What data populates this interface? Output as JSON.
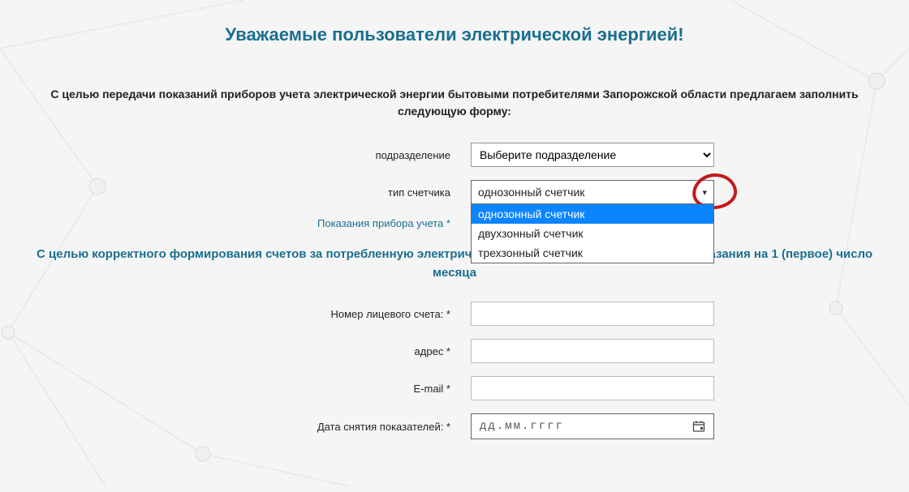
{
  "title": "Уважаемые пользователи электрической энергией!",
  "intro": "С целью передачи показаний приборов учета электрической энергии бытовыми потребителями Запорожской области предлагаем заполнить следующую форму:",
  "notice": "С целью корректного формирования счетов за потребленную электрическую энергию пожаловать давать показания на 1 (первое) число месяца",
  "labels": {
    "department": "подразделение",
    "meterType": "тип счетчика",
    "readings": "Показания прибора учета *",
    "account": "Номер лицевого счета: *",
    "address": "адрес *",
    "email": "E-mail *",
    "date": "Дата снятия показателей: *"
  },
  "fields": {
    "department": {
      "selected": "Выберите подразделение"
    },
    "meterType": {
      "selected": "однозонный счетчик",
      "options": [
        "однозонный счетчик",
        "двухзонный счетчик",
        "трехзонный счетчик"
      ]
    },
    "account": "",
    "address": "",
    "email": "",
    "date_placeholder": "дд.мм.гггг"
  }
}
